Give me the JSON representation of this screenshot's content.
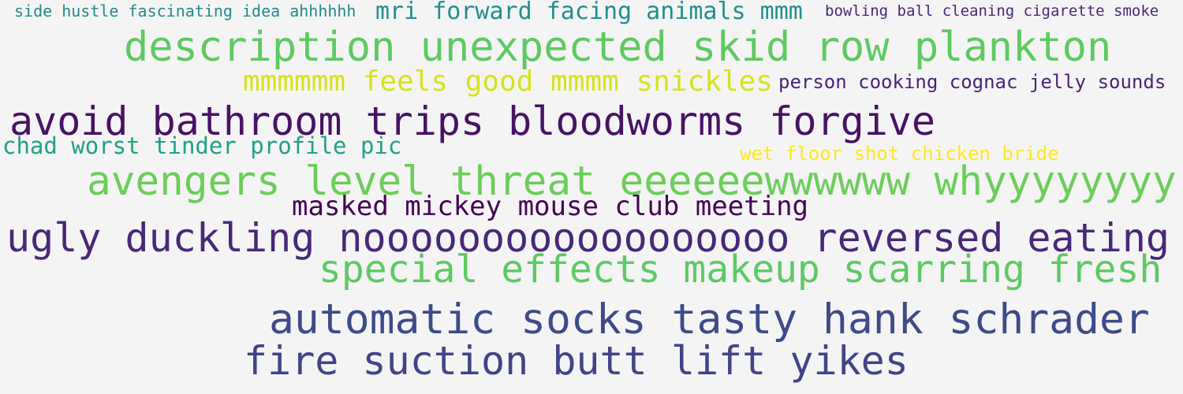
{
  "background": "#f4f4f4",
  "words": [
    {
      "text": "side hustle fascinating idea ahhhhhh",
      "color": "#238a8d"
    },
    {
      "text": "mri forward facing animals mmm",
      "color": "#218f8d"
    },
    {
      "text": "bowling ball cleaning cigarette smoke",
      "color": "#482777"
    },
    {
      "text": "description unexpected skid row plankton",
      "color": "#5ec962"
    },
    {
      "text": "mmmmmm feels good mmmm snickles",
      "color": "#d8e219"
    },
    {
      "text": "person cooking cognac jelly sounds",
      "color": "#482475"
    },
    {
      "text": "avoid bathroom trips bloodworms forgive",
      "color": "#471365"
    },
    {
      "text": "chad worst tinder profile pic",
      "color": "#1fa187"
    },
    {
      "text": "wet floor shot chicken bride",
      "color": "#fde725"
    },
    {
      "text": "avengers level threat eeeeeewwwwww whyyyyyyyy",
      "color": "#6ccd5a"
    },
    {
      "text": "masked mickey mouse club meeting",
      "color": "#440154"
    },
    {
      "text": "ugly duckling noooooooooooooooooo reversed eating",
      "color": "#482878"
    },
    {
      "text": "special effects makeup scarring fresh",
      "color": "#5ec962"
    },
    {
      "text": "automatic socks tasty hank schrader",
      "color": "#3e4a89"
    },
    {
      "text": "fire suction butt lift yikes",
      "color": "#414487"
    }
  ]
}
